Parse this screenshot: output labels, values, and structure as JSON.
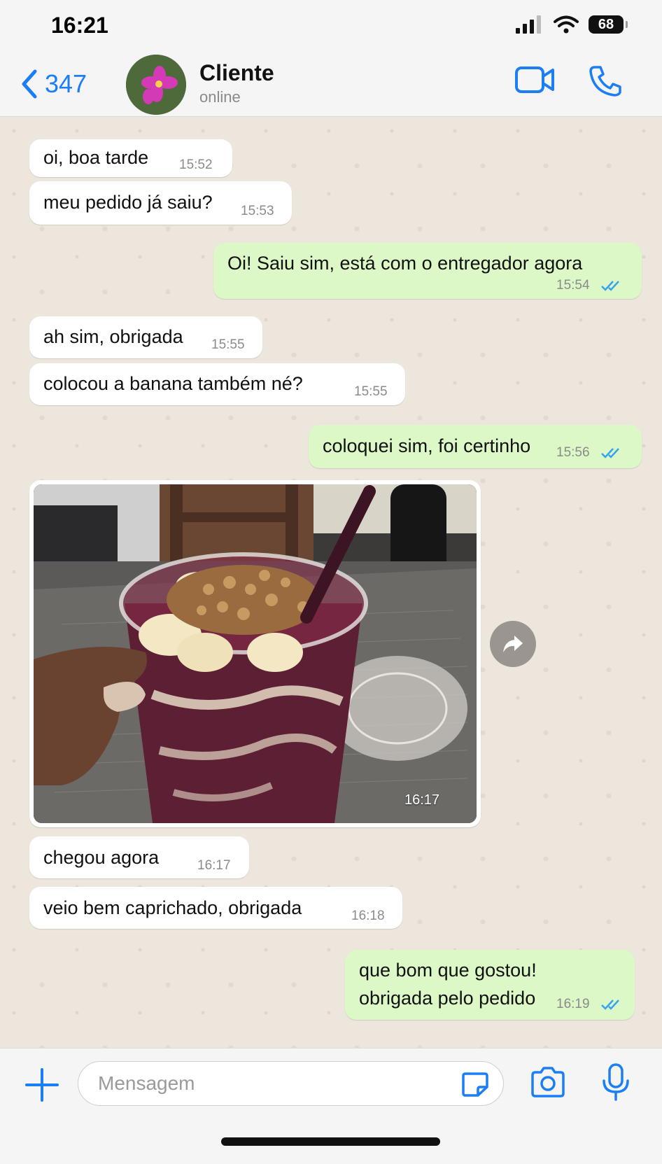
{
  "status_bar": {
    "time": "16:21",
    "battery": "68"
  },
  "header": {
    "back_count": "347",
    "contact_name": "Cliente",
    "contact_status": "online"
  },
  "messages": [
    {
      "dir": "in",
      "text": "oi, boa tarde",
      "time": "15:52"
    },
    {
      "dir": "in",
      "text": "meu pedido já saiu?",
      "time": "15:53"
    },
    {
      "dir": "out",
      "text": "Oi! Saiu sim, está com o entregador agora",
      "time": "15:54"
    },
    {
      "dir": "in",
      "text": "ah sim, obrigada",
      "time": "15:55"
    },
    {
      "dir": "in",
      "text": "colocou a banana também né?",
      "time": "15:55"
    },
    {
      "dir": "out",
      "text": "coloquei sim, foi certinho",
      "time": "15:56"
    },
    {
      "dir": "in",
      "type": "image",
      "time": "16:17"
    },
    {
      "dir": "in",
      "text": "chegou agora",
      "time": "16:17"
    },
    {
      "dir": "in",
      "text": "veio bem caprichado, obrigada",
      "time": "16:18"
    },
    {
      "dir": "out",
      "lines": [
        "que bom que gostou!",
        "obrigada pelo pedido"
      ],
      "time": "16:19"
    }
  ],
  "input": {
    "placeholder": "Mensagem"
  },
  "colors": {
    "accent": "#1c7ef5",
    "outgoing_bubble": "#dcf8c6",
    "incoming_bubble": "#ffffff",
    "read_ticks": "#34a3f0"
  },
  "icons": [
    "chevron-left-icon",
    "video-call-icon",
    "phone-icon",
    "forward-icon",
    "plus-icon",
    "sticker-icon",
    "camera-icon",
    "microphone-icon"
  ]
}
